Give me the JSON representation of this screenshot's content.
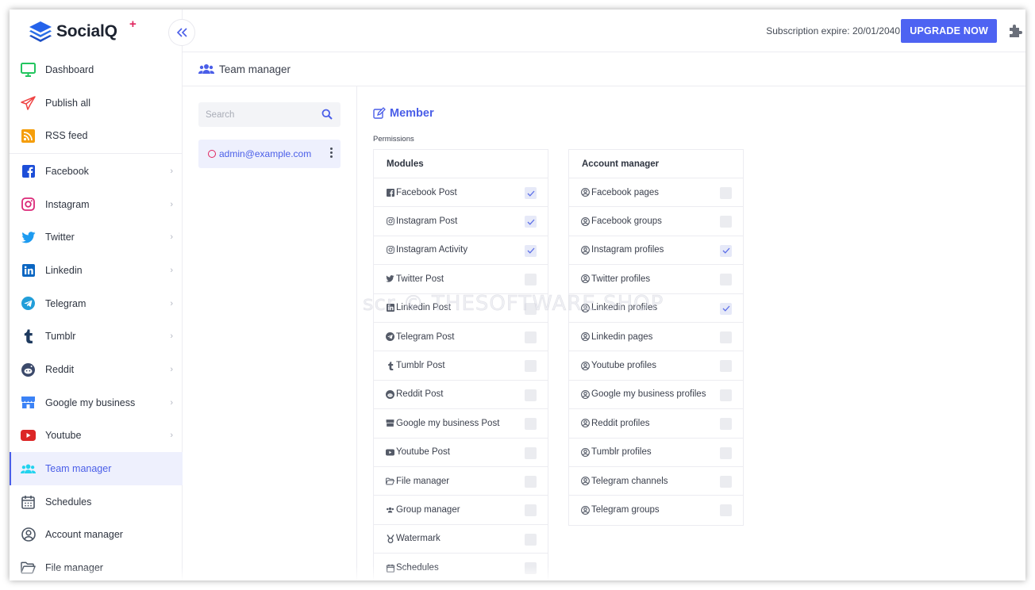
{
  "app": {
    "name": "SocialQ",
    "plus": "+"
  },
  "topbar": {
    "subscription_text": "Subscription expire: 20/01/2040",
    "upgrade_label": "UPGRADE NOW"
  },
  "sidebar": {
    "items": [
      {
        "label": "Dashboard",
        "icon": "monitor-icon"
      },
      {
        "label": "Publish all",
        "icon": "paper-plane-icon"
      },
      {
        "label": "RSS feed",
        "icon": "rss-icon"
      },
      {
        "label": "Facebook",
        "icon": "facebook-icon",
        "chevron": true
      },
      {
        "label": "Instagram",
        "icon": "instagram-icon",
        "chevron": true
      },
      {
        "label": "Twitter",
        "icon": "twitter-icon",
        "chevron": true
      },
      {
        "label": "Linkedin",
        "icon": "linkedin-icon",
        "chevron": true
      },
      {
        "label": "Telegram",
        "icon": "telegram-icon",
        "chevron": true
      },
      {
        "label": "Tumblr",
        "icon": "tumblr-icon",
        "chevron": true
      },
      {
        "label": "Reddit",
        "icon": "reddit-icon",
        "chevron": true
      },
      {
        "label": "Google my business",
        "icon": "store-icon",
        "chevron": true
      },
      {
        "label": "Youtube",
        "icon": "youtube-icon",
        "chevron": true
      },
      {
        "label": "Team manager",
        "icon": "users-icon",
        "active": true
      },
      {
        "label": "Schedules",
        "icon": "calendar-icon"
      },
      {
        "label": "Account manager",
        "icon": "user-circle-icon"
      },
      {
        "label": "File manager",
        "icon": "folder-icon"
      }
    ]
  },
  "page": {
    "title": "Team manager"
  },
  "members": {
    "search_placeholder": "Search",
    "items": [
      {
        "email": "admin@example.com"
      }
    ]
  },
  "member_panel": {
    "title": "Member",
    "permissions_label": "Permissions",
    "modules": {
      "header": "Modules",
      "rows": [
        {
          "label": "Facebook Post",
          "icon": "facebook-square-icon",
          "checked": true
        },
        {
          "label": "Instagram Post",
          "icon": "instagram-icon",
          "checked": true
        },
        {
          "label": "Instagram Activity",
          "icon": "instagram-icon",
          "checked": true
        },
        {
          "label": "Twitter Post",
          "icon": "twitter-icon",
          "checked": false
        },
        {
          "label": "Linkedin Post",
          "icon": "linkedin-icon",
          "checked": false
        },
        {
          "label": "Telegram Post",
          "icon": "telegram-icon",
          "checked": false
        },
        {
          "label": "Tumblr Post",
          "icon": "tumblr-icon",
          "checked": false
        },
        {
          "label": "Reddit Post",
          "icon": "reddit-icon",
          "checked": false
        },
        {
          "label": "Google my business Post",
          "icon": "store-icon",
          "checked": false
        },
        {
          "label": "Youtube Post",
          "icon": "youtube-icon",
          "checked": false
        },
        {
          "label": "File manager",
          "icon": "folder-icon",
          "checked": false
        },
        {
          "label": "Group manager",
          "icon": "users-icon",
          "checked": false
        },
        {
          "label": "Watermark",
          "icon": "medal-icon",
          "checked": false
        },
        {
          "label": "Schedules",
          "icon": "calendar-icon",
          "checked": false
        }
      ]
    },
    "accounts": {
      "header": "Account manager",
      "rows": [
        {
          "label": "Facebook pages",
          "checked": false
        },
        {
          "label": "Facebook groups",
          "checked": false
        },
        {
          "label": "Instagram profiles",
          "checked": true
        },
        {
          "label": "Twitter profiles",
          "checked": false
        },
        {
          "label": "Linkedin profiles",
          "checked": true
        },
        {
          "label": "Linkedin pages",
          "checked": false
        },
        {
          "label": "Youtube profiles",
          "checked": false
        },
        {
          "label": "Google my business profiles",
          "checked": false
        },
        {
          "label": "Reddit profiles",
          "checked": false
        },
        {
          "label": "Tumblr profiles",
          "checked": false
        },
        {
          "label": "Telegram channels",
          "checked": false
        },
        {
          "label": "Telegram groups",
          "checked": false
        }
      ]
    }
  },
  "watermark_text": "scr © THESOFTWARE.SHOP",
  "colors": {
    "accent": "#4e63f2",
    "active_bg": "#eef0fd",
    "brand_pink": "#e0245e"
  }
}
